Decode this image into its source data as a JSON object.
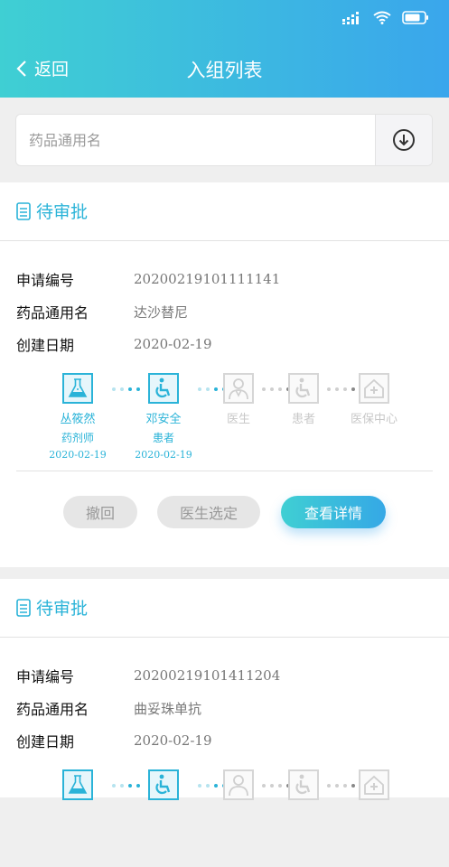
{
  "header": {
    "back_label": "返回",
    "title": "入组列表"
  },
  "search": {
    "placeholder": "药品通用名"
  },
  "labels": {
    "apply_no": "申请编号",
    "drug_name": "药品通用名",
    "created": "创建日期"
  },
  "cards": [
    {
      "status": "待审批",
      "apply_no": "20200219101111141",
      "drug_name": "达沙替尼",
      "created": "2020-02-19",
      "steps": [
        {
          "name": "丛筱然",
          "role": "药剂师",
          "date": "2020-02-19",
          "icon": "lab-flask-icon",
          "active": true
        },
        {
          "name": "邓安全",
          "role": "患者",
          "date": "2020-02-19",
          "icon": "wheelchair-icon",
          "active": true
        },
        {
          "name": "医生",
          "role": "",
          "date": "",
          "icon": "doctor-icon",
          "active": false
        },
        {
          "name": "患者",
          "role": "",
          "date": "",
          "icon": "wheelchair-icon",
          "active": false
        },
        {
          "name": "医保中心",
          "role": "",
          "date": "",
          "icon": "home-shield-icon",
          "active": false
        }
      ],
      "actions": {
        "revoke": "撤回",
        "choose_doctor": "医生选定",
        "view_detail": "查看详情"
      }
    },
    {
      "status": "待审批",
      "apply_no": "20200219101411204",
      "drug_name": "曲妥珠单抗",
      "created": "2020-02-19"
    }
  ],
  "colors": {
    "accent": "#2ab3d8",
    "header_start": "#3fcfd3",
    "header_end": "#3aa6ec"
  }
}
